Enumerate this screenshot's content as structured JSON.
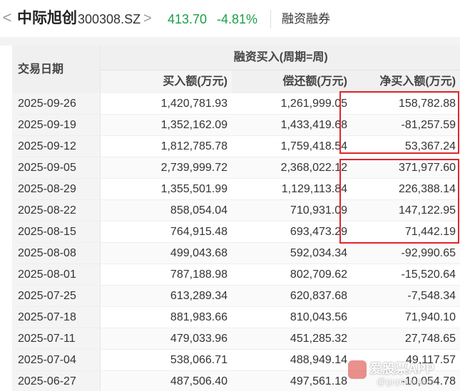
{
  "header": {
    "back_label": "<",
    "stock_name": "中际旭创",
    "stock_code": "300308.SZ",
    "chevron": ">",
    "price": "413.70",
    "change_pct": "-4.81%",
    "tab_label": "融资融券"
  },
  "colors": {
    "down": "#1a9f46",
    "highlight": "#e0252b"
  },
  "table": {
    "date_header": "交易日期",
    "group_header": "融资买入(周期=周)",
    "columns": [
      "买入额(万元)",
      "偿还额(万元)",
      "净买入额(万元)"
    ],
    "rows": [
      [
        "2025-09-26",
        "1,420,781.93",
        "1,261,999.05",
        "158,782.88"
      ],
      [
        "2025-09-19",
        "1,352,162.09",
        "1,433,419.68",
        "-81,257.59"
      ],
      [
        "2025-09-12",
        "1,812,785.78",
        "1,759,418.54",
        "53,367.24"
      ],
      [
        "2025-09-05",
        "2,739,999.72",
        "2,368,022.12",
        "371,977.60"
      ],
      [
        "2025-08-29",
        "1,355,501.99",
        "1,129,113.84",
        "226,388.14"
      ],
      [
        "2025-08-22",
        "858,054.04",
        "710,931.09",
        "147,122.95"
      ],
      [
        "2025-08-15",
        "764,915.48",
        "693,473.29",
        "71,442.19"
      ],
      [
        "2025-08-08",
        "499,043.68",
        "592,034.34",
        "-92,990.65"
      ],
      [
        "2025-08-01",
        "787,188.98",
        "802,709.62",
        "-15,520.64"
      ],
      [
        "2025-07-25",
        "613,289.34",
        "620,837.68",
        "-7,548.34"
      ],
      [
        "2025-07-18",
        "881,983.66",
        "810,043.56",
        "71,940.10"
      ],
      [
        "2025-07-11",
        "479,033.96",
        "451,285.32",
        "27,748.65"
      ],
      [
        "2025-07-04",
        "538,066.71",
        "488,949.14",
        "49,117.57"
      ],
      [
        "2025-06-27",
        "487,506.40",
        "497,561.18",
        "-10,054.78"
      ]
    ]
  },
  "watermark": {
    "text": "爱股票APP",
    "sub": "@gupiao.com"
  }
}
